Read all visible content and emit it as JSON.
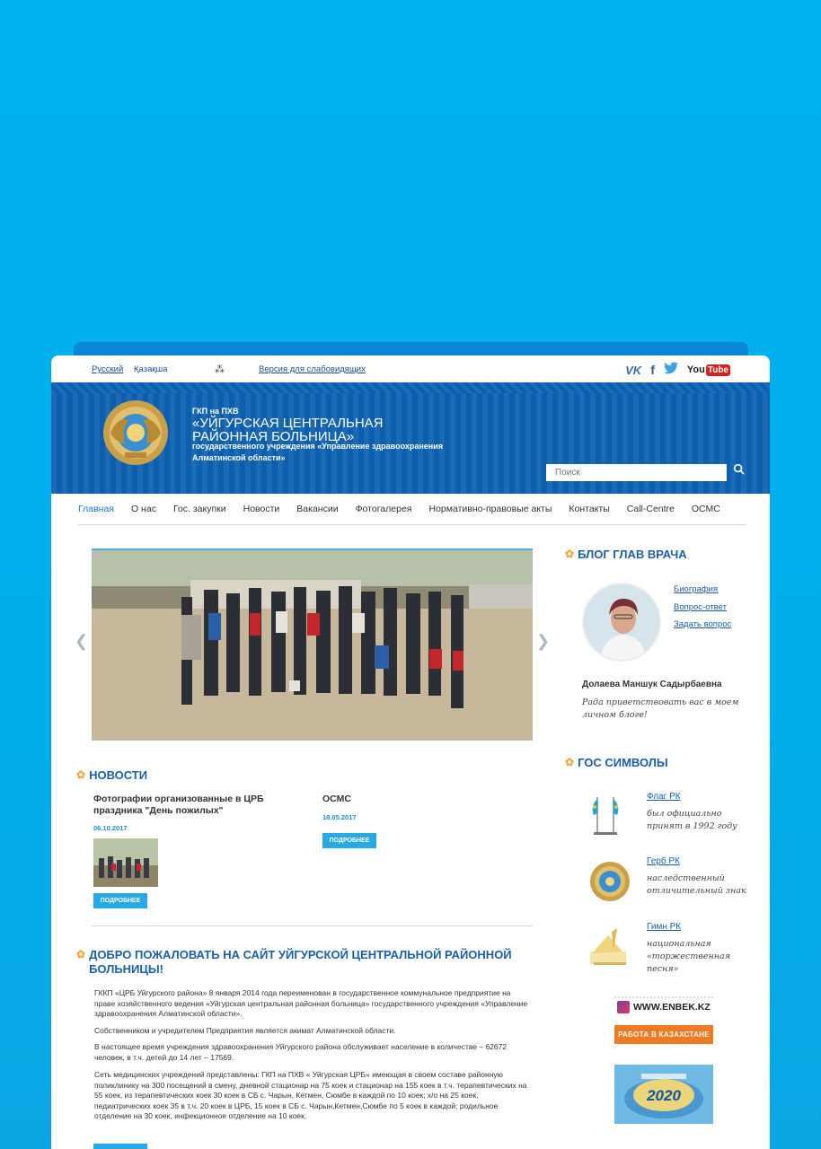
{
  "topbar": {
    "lang_ru": "Русский",
    "lang_kz": "Қазақша",
    "low_vision": "Версия для слабовидящих",
    "social": {
      "vk": "VK",
      "fb": "f",
      "tw": "🐦",
      "yt_you": "You",
      "yt_tube": "Tube"
    }
  },
  "header": {
    "line1": "ГКП на ПХВ",
    "name": "«Уйгурская центральная районная больница»",
    "sub": "государственного учреждения «Управление здравоохранения Алматинской области»",
    "search_placeholder": "Поиск"
  },
  "nav": {
    "items": [
      "Главная",
      "О нас",
      "Гос. закупки",
      "Новости",
      "Вакансии",
      "Фотогалерея",
      "Нормативно-правовые акты",
      "Контакты",
      "Call-Centre",
      "ОСМС"
    ]
  },
  "news": {
    "heading": "Новости",
    "items": [
      {
        "title": "Фотографии организованные в ЦРБ праздника \"День пожилых\"",
        "date": "06.10.2017",
        "more": "ПОДРОБНЕЕ"
      },
      {
        "title": "ОСМС",
        "date": "18.05.2017",
        "more": "ПОДРОБНЕЕ"
      }
    ]
  },
  "welcome": {
    "heading": "Добро пожаловать на сайт Уйгурской центральной районной больницы!",
    "paragraphs": [
      "ГККП «ЦРБ Уйгурского района» 8 января 2014 года переименован в государственное коммунальное предприятие на праве хозяйственного ведения «Уйгурская центральная районная больница» государственного учреждения «Управление здравоохранения Алматинской области».",
      "Собственником и учредителем Предприятия является акимат Алматинской области.",
      "В настоящее время учреждения здравоохранения Уйгурского района обслуживает население в количестве – 62672 человек, в т.ч. детей до 14 лет – 17569.",
      "Сеть медицинских учреждений представлены: ГКП на ПХВ « Уйгурская ЦРБ» имеющая в своем составе районную поликлинику на 300 посещений в смену, дневной стационар на 75 коек и стационар на 155 коек в т.ч. терапевтических на 55 коек, из терапевтических коек 30 коек в СБ с. Чарын, Кетмен, Сюмбе в каждой по 10 коек; х/о на 25 коек, педиатрических коек 35 в т.ч. 20 коек в ЦРБ, 15 коек в СБ с. Чарын,Кетмен,Сюмбе по 5 коек в каждой; родильное отделение на 30 коек, инфекционное отделение на 10 коек."
    ]
  },
  "blog": {
    "heading": "Блог глав врача",
    "links": [
      "Биография",
      "Вопрос-ответ",
      "Задать вопрос"
    ],
    "doctor_name": "Долаева Маншук Садырбаевна",
    "quote": "Рада приветствовать вас в моем личном блоге!"
  },
  "symbols": {
    "heading": "Гос символы",
    "items": [
      {
        "link": "Флаг РК",
        "desc": "был официально принят в 1992 году"
      },
      {
        "link": "Герб РК",
        "desc": "наследственный отличительный знак"
      },
      {
        "link": "Гимн РК",
        "desc": "национальная «торжественная песня»"
      }
    ]
  },
  "banners": {
    "enbek": "WWW.ENBEK.KZ",
    "enbek_btn": "РАБОТА В КАЗАХСТАНЕ",
    "year": "2020"
  }
}
